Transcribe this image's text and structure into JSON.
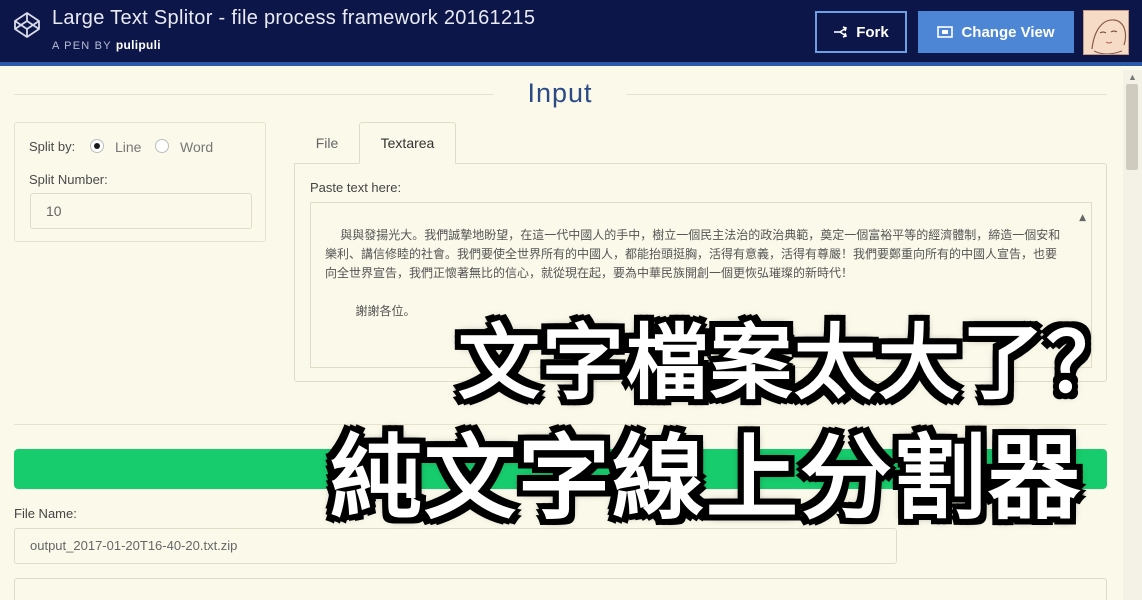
{
  "header": {
    "pen_title": "Large Text Splitor - file process framework 20161215",
    "pen_by_prefix": "A PEN BY",
    "author": "pulipuli",
    "fork_label": "Fork",
    "change_view_label": "Change View",
    "colors": {
      "bar": "#0d1648",
      "accent": "#4d86d4"
    }
  },
  "input_section": {
    "title": "Input",
    "split_by_label": "Split by:",
    "split_options": [
      {
        "label": "Line",
        "checked": true
      },
      {
        "label": "Word",
        "checked": false
      }
    ],
    "split_number_label": "Split Number:",
    "split_number_value": "10",
    "tabs": [
      {
        "label": "File",
        "active": false
      },
      {
        "label": "Textarea",
        "active": true
      }
    ],
    "paste_label": "Paste text here:",
    "textarea_content": "與與發揚光大。我們誠摯地盼望，在這一代中國人的手中，樹立一個民主法治的政治典範，奠定一個富裕平等的經濟體制，締造一個安和樂利、講信修睦的社會。我們要使全世界所有的中國人，都能抬頭挺胸，活得有意義，活得有尊嚴！我們要鄭重向所有的中國人宣告，也要向全世界宣告，我們正懷著無比的信心，就從現在起，要為中華民族開創一個更恢弘璀璨的新時代！\n\n        謝謝各位。"
  },
  "progress": {
    "fraction": 1.0,
    "color": "#17cc6c"
  },
  "output_section": {
    "file_name_label": "File Name:",
    "file_name_value": "output_2017-01-20T16-40-20.txt.zip"
  },
  "overlay": {
    "line1": "文字檔案太大了？",
    "line2": "純文字線上分割器"
  }
}
